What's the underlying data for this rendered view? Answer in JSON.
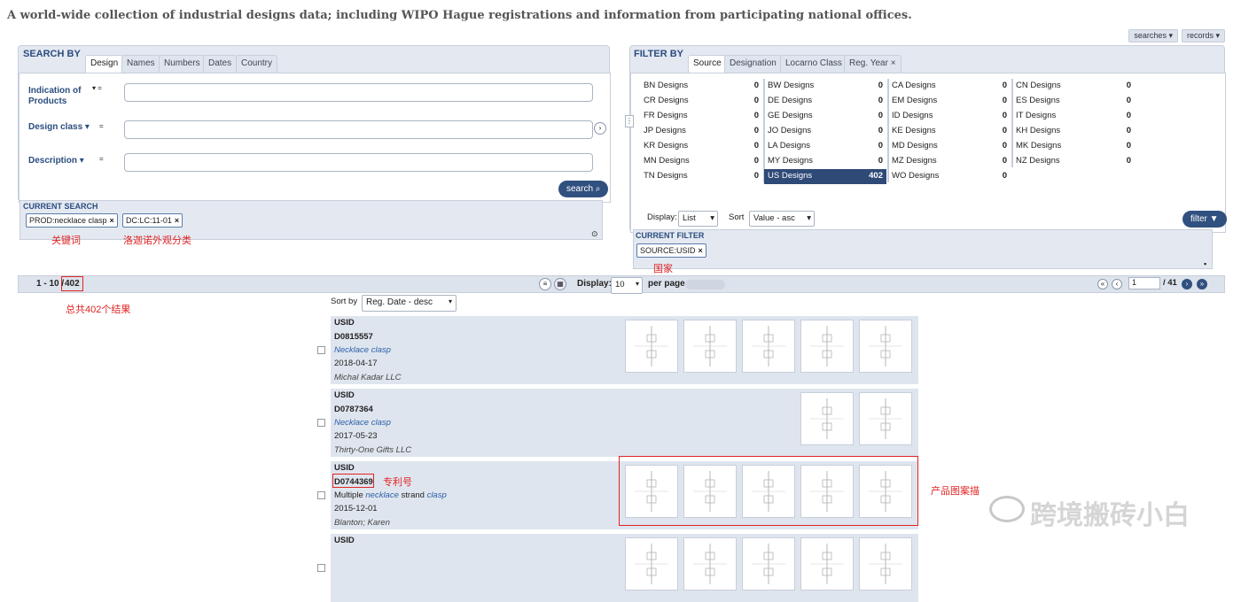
{
  "tagline": "A world-wide collection of industrial designs data; including WIPO Hague registrations and information from participating national offices.",
  "top_buttons": [
    "searches ▾",
    "records ▾"
  ],
  "search": {
    "title": "SEARCH BY",
    "tabs": [
      "Design",
      "Names",
      "Numbers",
      "Dates",
      "Country"
    ],
    "fields": [
      {
        "label": "Indication of Products",
        "value": "",
        "op": "="
      },
      {
        "label": "Design class",
        "value": "",
        "op": "="
      },
      {
        "label": "Description",
        "value": "",
        "op": "="
      }
    ],
    "button": "search ⌕",
    "current_label": "CURRENT SEARCH",
    "chips": [
      "PROD:necklace clasp",
      "DC:LC:11-01"
    ]
  },
  "annotations": {
    "keyword": "关键词",
    "locarno": "洛迦诺外观分类",
    "country": "国家",
    "total": "总共402个结果",
    "patent_no": "专利号",
    "images": "产品图案描"
  },
  "filter": {
    "title": "FILTER BY",
    "tabs": [
      "Source",
      "Designation",
      "Locarno Class",
      "Reg. Year ×"
    ],
    "columns": [
      [
        [
          "BN Designs",
          "0"
        ],
        [
          "CR Designs",
          "0"
        ],
        [
          "FR Designs",
          "0"
        ],
        [
          "JP Designs",
          "0"
        ],
        [
          "KR Designs",
          "0"
        ],
        [
          "MN Designs",
          "0"
        ],
        [
          "TN Designs",
          "0"
        ]
      ],
      [
        [
          "BW Designs",
          "0"
        ],
        [
          "DE Designs",
          "0"
        ],
        [
          "GE Designs",
          "0"
        ],
        [
          "JO Designs",
          "0"
        ],
        [
          "LA Designs",
          "0"
        ],
        [
          "MY Designs",
          "0"
        ],
        [
          "US Designs",
          "402"
        ]
      ],
      [
        [
          "CA Designs",
          "0"
        ],
        [
          "EM Designs",
          "0"
        ],
        [
          "ID Designs",
          "0"
        ],
        [
          "KE Designs",
          "0"
        ],
        [
          "MD Designs",
          "0"
        ],
        [
          "MZ Designs",
          "0"
        ],
        [
          "WO Designs",
          "0"
        ]
      ],
      [
        [
          "CN Designs",
          "0"
        ],
        [
          "ES Designs",
          "0"
        ],
        [
          "IT Designs",
          "0"
        ],
        [
          "KH Designs",
          "0"
        ],
        [
          "MK Designs",
          "0"
        ],
        [
          "NZ Designs",
          "0"
        ]
      ]
    ],
    "display_label": "Display:",
    "display_value": "List",
    "sort_label": "Sort",
    "sort_value": "Value - asc",
    "button": "filter ▼",
    "current_label": "CURRENT FILTER",
    "chips": [
      "SOURCE:USID"
    ]
  },
  "results_bar": {
    "range": "1 - 10",
    "sep": "/",
    "total": "402",
    "display_label": "Display:",
    "display_value": "10",
    "per_page": "per page",
    "page": "1",
    "pages": "/ 41"
  },
  "sort": {
    "label": "Sort by",
    "value": "Reg. Date - desc"
  },
  "results": [
    {
      "source": "USID",
      "number": "D0815557",
      "product_parts": [
        "Necklace clasp"
      ],
      "date": "2018-04-17",
      "owner": "Michal Kadar LLC",
      "thumbs": 5
    },
    {
      "source": "USID",
      "number": "D0787364",
      "product_parts": [
        "Necklace clasp"
      ],
      "date": "2017-05-23",
      "owner": "Thirty-One Gifts LLC",
      "thumbs": 2
    },
    {
      "source": "USID",
      "number": "D0744369",
      "product_parts": [
        "Multiple ",
        "necklace",
        " strand ",
        "clasp"
      ],
      "date": "2015-12-01",
      "owner": "Blanton; Karen",
      "thumbs": 5
    },
    {
      "source": "USID",
      "number": "",
      "product_parts": [],
      "date": "",
      "owner": "",
      "thumbs": 5
    }
  ],
  "watermark": "跨境搬砖小白"
}
